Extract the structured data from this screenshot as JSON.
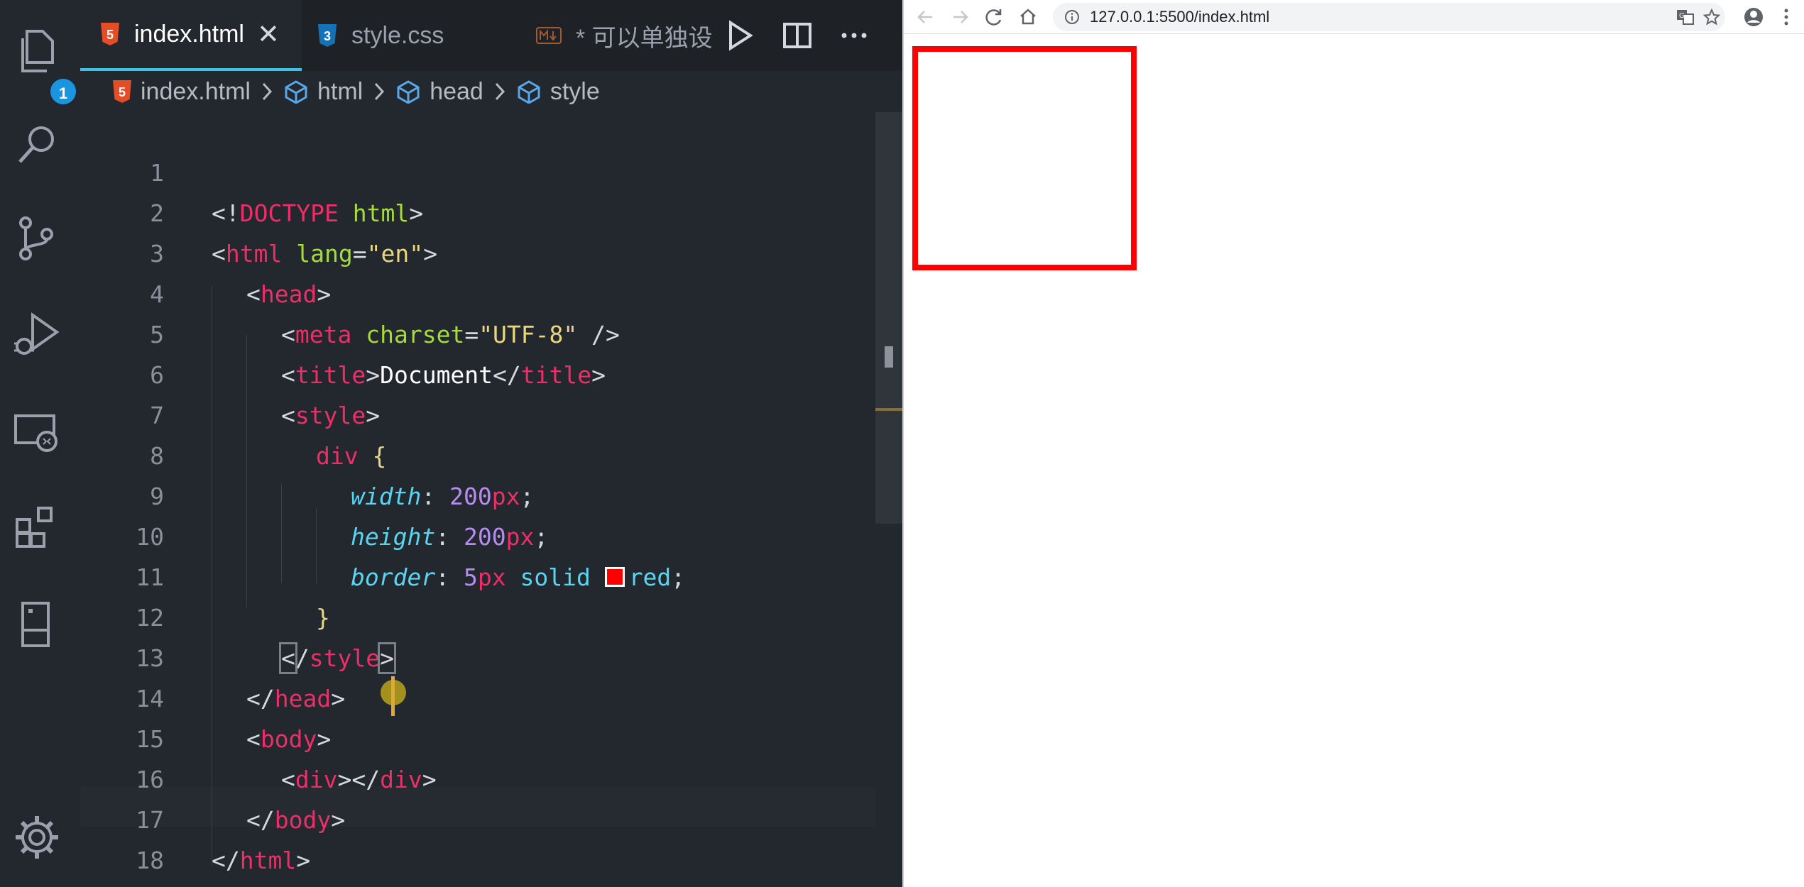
{
  "editor": {
    "activity_badge": "1",
    "tabs": [
      {
        "label": "index.html",
        "close": "✕"
      },
      {
        "label": "style.css"
      },
      {
        "label": "* 可以单独设"
      }
    ],
    "breadcrumb": [
      "index.html",
      "html",
      "head",
      "style"
    ],
    "line_numbers": [
      "1",
      "2",
      "3",
      "4",
      "5",
      "6",
      "7",
      "8",
      "9",
      "10",
      "11",
      "12",
      "13",
      "14",
      "15",
      "16",
      "17",
      "18"
    ],
    "code": {
      "l1": [
        "<!",
        "DOCTYPE",
        " ",
        "html",
        ">"
      ],
      "l2": [
        "<",
        "html",
        " ",
        "lang",
        "=",
        "\"en\"",
        ">"
      ],
      "l3": [
        "<",
        "head",
        ">"
      ],
      "l4": [
        "<",
        "meta",
        " ",
        "charset",
        "=",
        "\"UTF-8\"",
        " />"
      ],
      "l5": [
        "<",
        "title",
        ">",
        "Document",
        "</",
        "title",
        ">"
      ],
      "l6": [
        "<",
        "style",
        ">"
      ],
      "l7": [
        "div",
        " ",
        "{"
      ],
      "l8": [
        "width",
        ": ",
        "200",
        "px",
        ";"
      ],
      "l9": [
        "height",
        ": ",
        "200",
        "px",
        ";"
      ],
      "l10": [
        "border",
        ": ",
        "5",
        "px",
        " ",
        "solid",
        " ",
        "red",
        ";"
      ],
      "l11": [
        "}"
      ],
      "l12": [
        "<",
        "/",
        "style",
        ">"
      ],
      "l13": [
        "</",
        "head",
        ">"
      ],
      "l14": [
        "<",
        "body",
        ">"
      ],
      "l15": [
        "<",
        "div",
        "></",
        "div",
        ">"
      ],
      "l16": [
        "</",
        "body",
        ">"
      ],
      "l17": [
        "</",
        "html",
        ">"
      ]
    }
  },
  "browser": {
    "url": "127.0.0.1:5500/index.html"
  },
  "colors": {
    "editor_bg": "#23272e",
    "tab_active_border": "#3fc0e8",
    "tag": "#ec2f67",
    "attr": "#a6dc3a",
    "string": "#e8d680",
    "property": "#5ad5f1",
    "number": "#b78cf2",
    "border_red": "#ff0000"
  }
}
